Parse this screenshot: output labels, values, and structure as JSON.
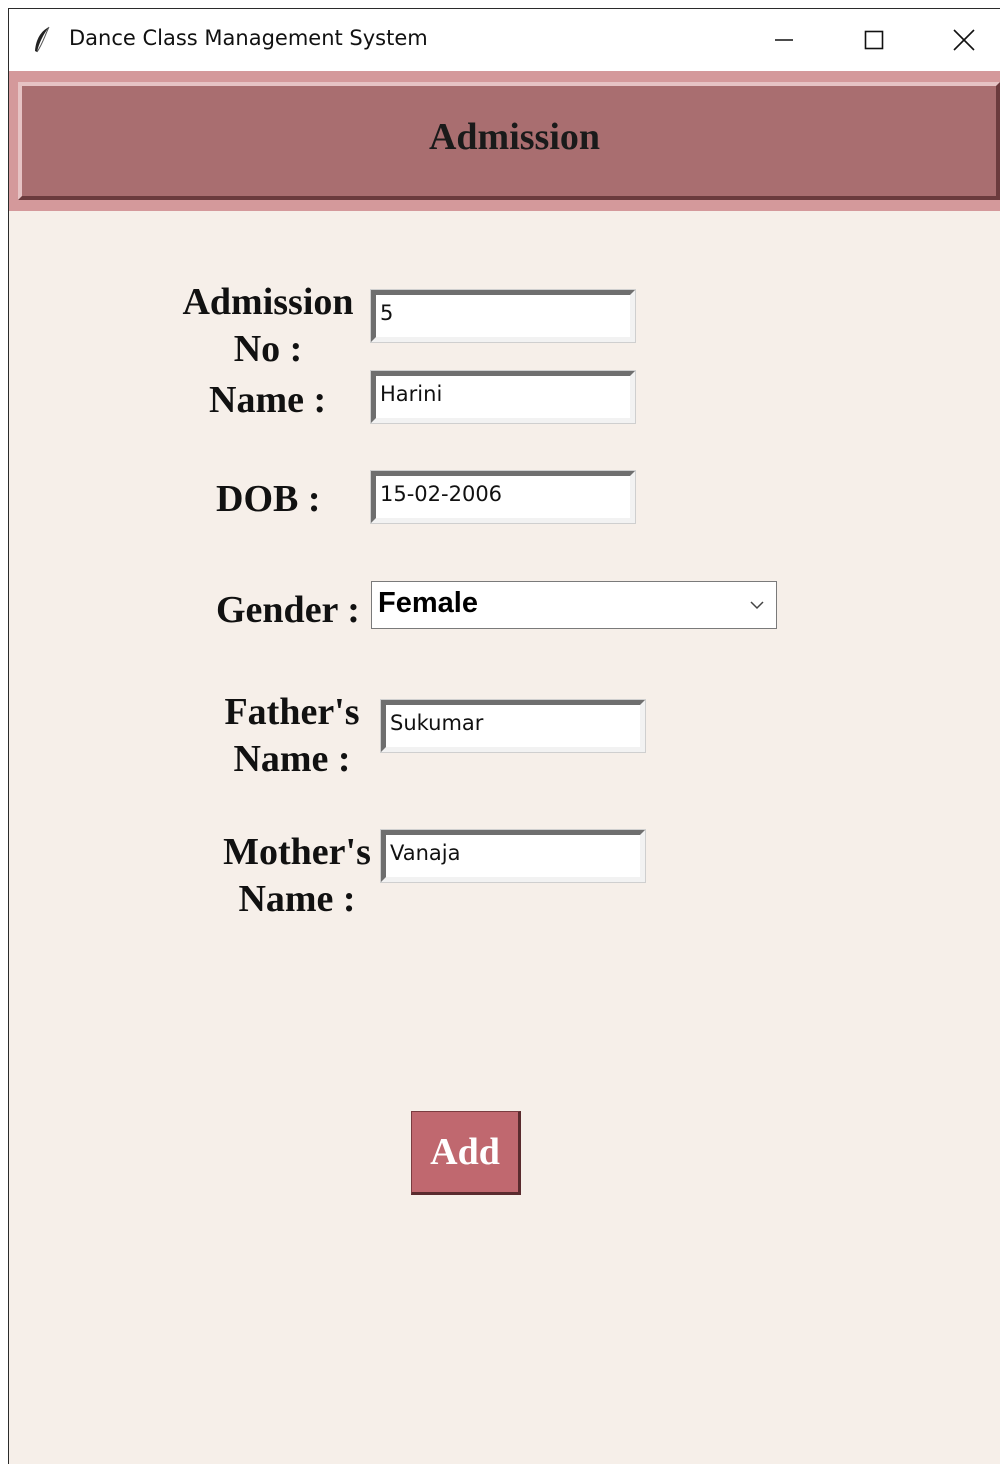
{
  "window": {
    "title": "Dance Class Management System",
    "icon": "feather-icon",
    "controls": [
      "minimize-icon",
      "maximize-icon",
      "close-icon"
    ]
  },
  "header": {
    "title": "Admission"
  },
  "form": {
    "admission_no": {
      "label": "Admission\nNo :",
      "value": "5"
    },
    "name": {
      "label": "Name :",
      "value": "Harini"
    },
    "dob": {
      "label": "DOB :",
      "value": "15-02-2006"
    },
    "gender": {
      "label": "Gender :",
      "value": "Female"
    },
    "father_name": {
      "label": "Father's\nName :",
      "value": "Sukumar"
    },
    "mother_name": {
      "label": "Mother's\nName :",
      "value": "Vanaja"
    }
  },
  "actions": {
    "add_label": "Add"
  },
  "colors": {
    "background": "#f6efe9",
    "header_panel": "#a96e70",
    "header_border": "#d4999b",
    "button": "#c0686f"
  }
}
